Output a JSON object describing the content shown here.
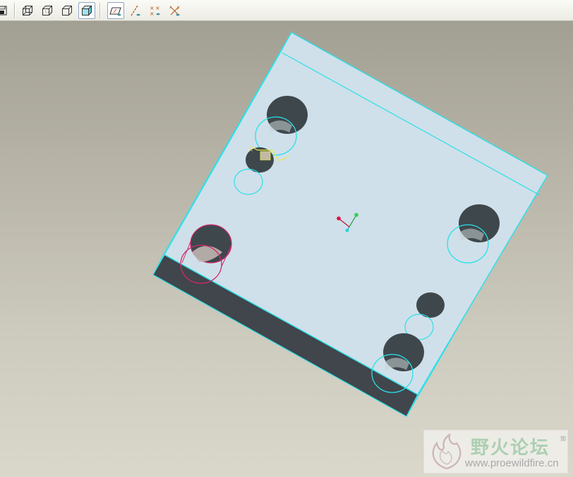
{
  "toolbar": {
    "buttons": [
      {
        "name": "save-copy-icon",
        "active": false
      },
      {
        "name": "wireframe-display-icon",
        "active": false
      },
      {
        "name": "hidden-line-display-icon",
        "active": false
      },
      {
        "name": "no-hidden-display-icon",
        "active": false
      },
      {
        "name": "shaded-display-icon",
        "active": true
      },
      {
        "name": "datum-planes-toggle-icon",
        "active": true
      },
      {
        "name": "datum-axes-toggle-icon",
        "active": false
      },
      {
        "name": "datum-points-toggle-icon",
        "active": false
      },
      {
        "name": "coordinate-systems-toggle-icon",
        "active": false
      }
    ]
  },
  "colors": {
    "face": "#cfe0ea",
    "edge": "#29e0e8",
    "dark_side": "#40464b",
    "hole": "#3e474c",
    "selection": "#d2286a",
    "highlight": "#e8e84a"
  },
  "watermark": {
    "title": "野火论坛",
    "url": "www.proewildfire.cn",
    "corner_text": "加"
  }
}
